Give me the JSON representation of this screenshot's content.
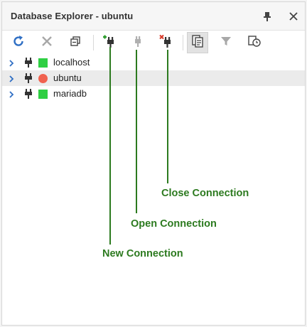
{
  "window": {
    "title": "Database Explorer - ubuntu"
  },
  "toolbar": {
    "buttons": [
      {
        "icon": "refresh-icon"
      },
      {
        "icon": "delete-icon"
      },
      {
        "icon": "collapse-all-icon"
      },
      {
        "icon": "new-connection-icon"
      },
      {
        "icon": "open-connection-icon"
      },
      {
        "icon": "close-connection-icon"
      },
      {
        "icon": "copy-icon"
      },
      {
        "icon": "filter-icon"
      },
      {
        "icon": "history-icon"
      }
    ]
  },
  "tree": {
    "nodes": [
      {
        "label": "localhost",
        "status": "connected",
        "status_color": "#2fcf43"
      },
      {
        "label": "ubuntu",
        "status": "error",
        "status_color": "#f0624f",
        "selected": true
      },
      {
        "label": "mariadb",
        "status": "connected",
        "status_color": "#2fcf43"
      }
    ]
  },
  "annotations": {
    "new_connection": "New Connection",
    "open_connection": "Open Connection",
    "close_connection": "Close Connection",
    "color": "#2c7a1f"
  }
}
